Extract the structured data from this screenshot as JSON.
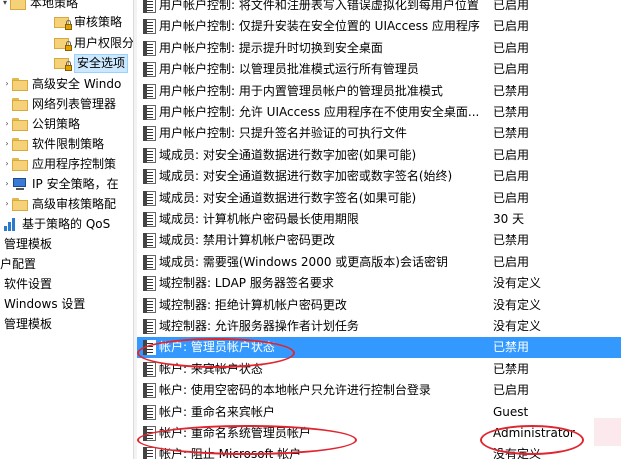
{
  "tree": {
    "items": [
      {
        "label": "本地策略",
        "icon": "folder-icon"
      },
      {
        "label": "审核策略",
        "icon": "lock-folder-icon"
      },
      {
        "label": "用户权限分配",
        "icon": "lock-folder-icon"
      },
      {
        "label": "安全选项",
        "icon": "lock-folder-icon"
      },
      {
        "label": "高级安全 Windo",
        "icon": "folder-icon"
      },
      {
        "label": "网络列表管理器",
        "icon": "folder-icon"
      },
      {
        "label": "公钥策略",
        "icon": "folder-icon"
      },
      {
        "label": "软件限制策略",
        "icon": "folder-icon"
      },
      {
        "label": "应用程序控制策",
        "icon": "folder-icon"
      },
      {
        "label": "IP 安全策略，在",
        "icon": "computer-icon"
      },
      {
        "label": "高级审核策略配",
        "icon": "folder-icon"
      },
      {
        "label": "基于策略的 QoS",
        "icon": "qos-chart-icon"
      },
      {
        "label": "管理模板"
      },
      {
        "label": "户配置"
      },
      {
        "label": "软件设置"
      },
      {
        "label": "Windows 设置"
      },
      {
        "label": "管理模板"
      }
    ]
  },
  "policies": [
    {
      "name": "用户帐户控制: 将文件和注册表写入错误虚拟化到每用户位置",
      "value": "已启用"
    },
    {
      "name": "用户帐户控制: 仅提升安装在安全位置的 UIAccess 应用程序",
      "value": "已启用"
    },
    {
      "name": "用户帐户控制: 提示提升时切换到安全桌面",
      "value": "已启用"
    },
    {
      "name": "用户帐户控制: 以管理员批准模式运行所有管理员",
      "value": "已启用"
    },
    {
      "name": "用户帐户控制: 用于内置管理员帐户的管理员批准模式",
      "value": "已禁用"
    },
    {
      "name": "用户帐户控制: 允许 UIAccess 应用程序在不使用安全桌面...",
      "value": "已禁用"
    },
    {
      "name": "用户帐户控制: 只提升签名并验证的可执行文件",
      "value": "已禁用"
    },
    {
      "name": "域成员: 对安全通道数据进行数字加密(如果可能)",
      "value": "已启用"
    },
    {
      "name": "域成员: 对安全通道数据进行数字加密或数字签名(始终)",
      "value": "已启用"
    },
    {
      "name": "域成员: 对安全通道数据进行数字签名(如果可能)",
      "value": "已启用"
    },
    {
      "name": "域成员: 计算机帐户密码最长使用期限",
      "value": "30 天"
    },
    {
      "name": "域成员: 禁用计算机帐户密码更改",
      "value": "已禁用"
    },
    {
      "name": "域成员: 需要强(Windows 2000 或更高版本)会话密钥",
      "value": "已启用"
    },
    {
      "name": "域控制器: LDAP 服务器签名要求",
      "value": "没有定义"
    },
    {
      "name": "域控制器: 拒绝计算机帐户密码更改",
      "value": "没有定义"
    },
    {
      "name": "域控制器: 允许服务器操作者计划任务",
      "value": "没有定义"
    },
    {
      "name": "帐户: 管理员帐户状态",
      "value": "已禁用"
    },
    {
      "name": "帐户: 来宾帐户状态",
      "value": "已禁用"
    },
    {
      "name": "帐户: 使用空密码的本地帐户只允许进行控制台登录",
      "value": "已启用"
    },
    {
      "name": "帐户: 重命名来宾帐户",
      "value": "Guest"
    },
    {
      "name": "帐户: 重命名系统管理员帐户",
      "value": "Administrator"
    },
    {
      "name": "帐户: 阻止 Microsoft 帐户",
      "value": "没有定义"
    }
  ],
  "annotation_color": "#e0252f",
  "selection_color": "#3399ff"
}
